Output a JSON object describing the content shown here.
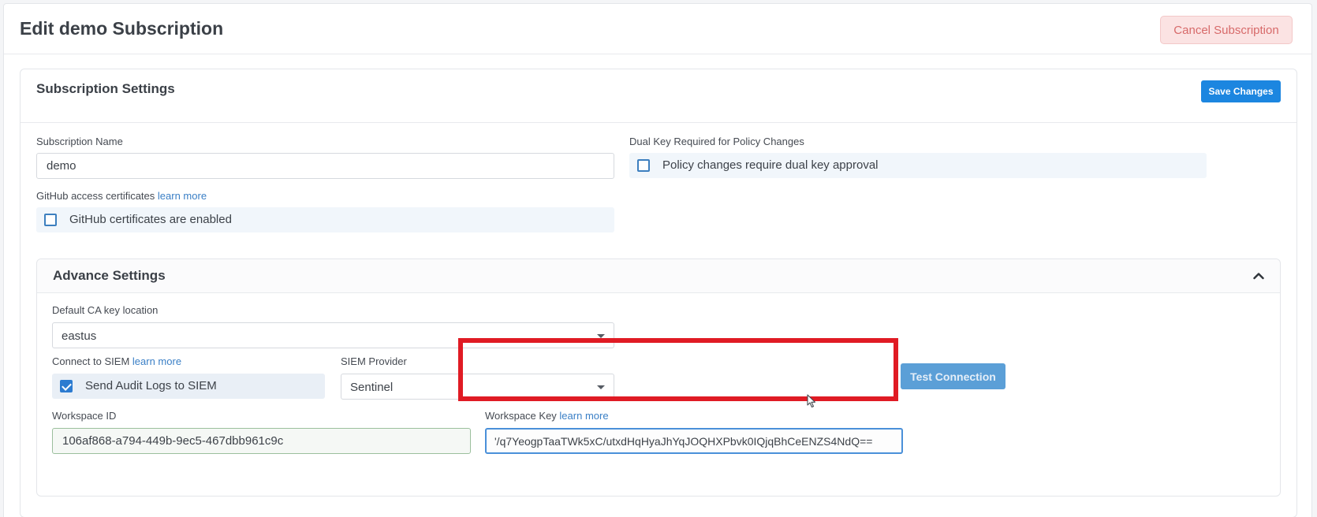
{
  "header": {
    "title": "Edit demo Subscription",
    "cancel_label": "Cancel Subscription"
  },
  "settings": {
    "title": "Subscription Settings",
    "save_label": "Save Changes",
    "subscription_name_label": "Subscription Name",
    "subscription_name_value": "demo",
    "dual_key_label": "Dual Key Required for Policy Changes",
    "dual_key_checkbox_label": "Policy changes require dual key approval",
    "dual_key_checked": false,
    "github_label": "GitHub access certificates",
    "github_link": "learn more",
    "github_checkbox_label": "GitHub certificates are enabled",
    "github_checked": false
  },
  "advance": {
    "title": "Advance Settings",
    "ca_location_label": "Default CA key location",
    "ca_location_value": "eastus",
    "siem_label": "Connect to SIEM",
    "siem_link": "learn more",
    "siem_checkbox_label": "Send Audit Logs to SIEM",
    "siem_checked": true,
    "siem_provider_label": "SIEM Provider",
    "siem_provider_value": "Sentinel",
    "workspace_id_label": "Workspace ID",
    "workspace_id_value": "106af868-a794-449b-9ec5-467dbb961c9c",
    "workspace_key_label": "Workspace Key",
    "workspace_key_link": "learn more",
    "workspace_key_value": "'/q7YeogpTaaTWk5xC/utxdHqHyaJhYqJOQHXPbvk0IQjqBhCeENZS4NdQ==",
    "test_label": "Test Connection"
  },
  "colors": {
    "primary": "#1c86e0",
    "danger_bg": "#fbe3e3",
    "danger_text": "#d76a6a",
    "highlight": "#e01b24"
  }
}
